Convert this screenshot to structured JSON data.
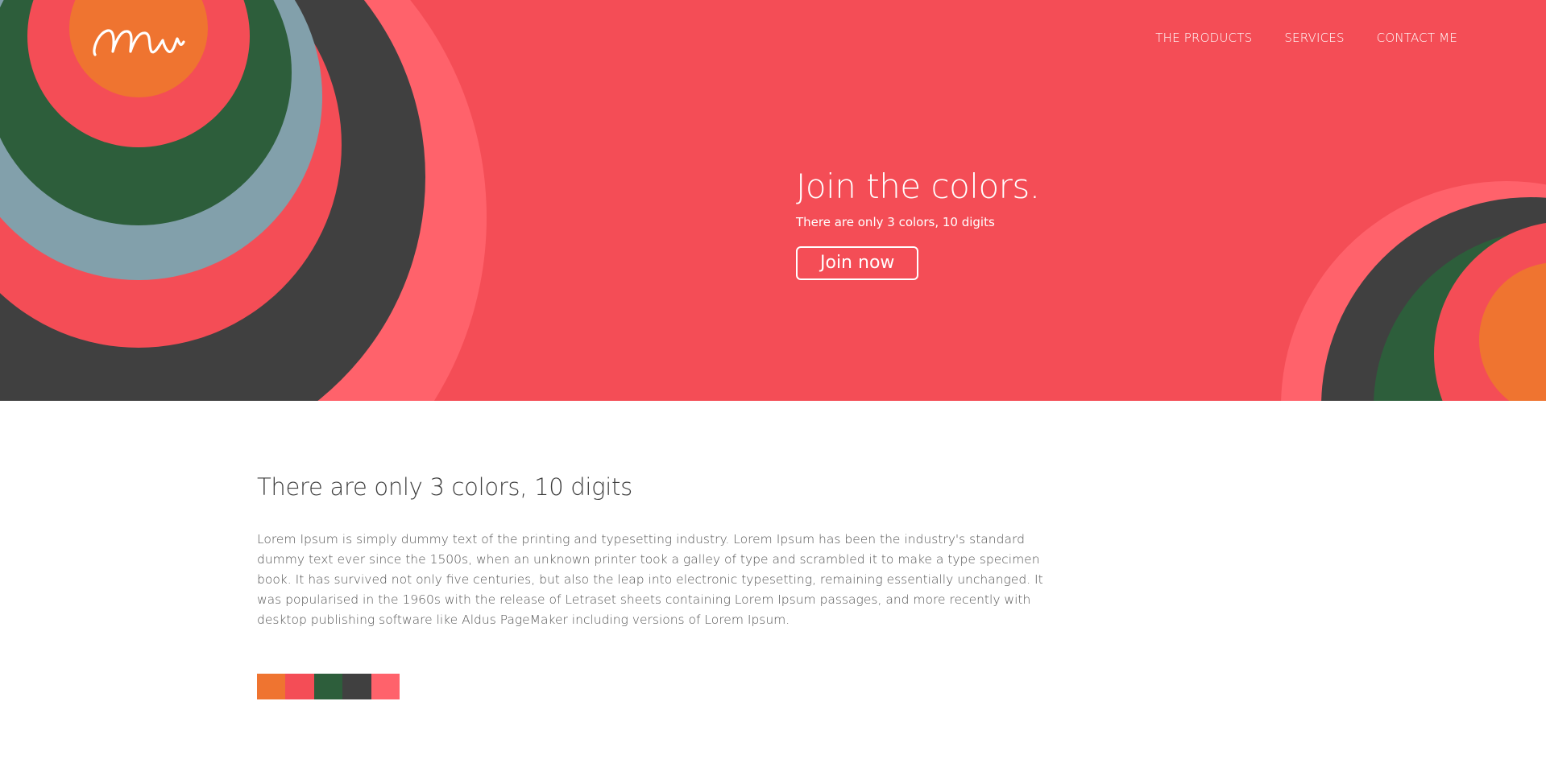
{
  "brand": {
    "logo_text": "Mw"
  },
  "nav": {
    "items": [
      {
        "label": "THE PRODUCTS"
      },
      {
        "label": "SERVICES"
      },
      {
        "label": "CONTACT ME"
      }
    ]
  },
  "hero": {
    "title": "Join the colors.",
    "subtitle": "There are only 3 colors, 10 digits",
    "button_label": "Join now"
  },
  "content": {
    "title": "There are only 3 colors, 10 digits",
    "body": "Lorem Ipsum is simply dummy text of the printing and typesetting industry. Lorem Ipsum has been the industry's standard dummy text ever since the 1500s, when an unknown printer took a galley of type and scrambled it to make a type specimen book. It has survived not only five centuries, but also the leap into electronic typesetting, remaining essentially unchanged. It was popularised in the 1960s with the release of Letraset sheets containing Lorem Ipsum passages, and more recently with desktop publishing software like Aldus PageMaker including versions of Lorem Ipsum."
  },
  "colors": {
    "orange": "#ef7430",
    "red": "#f44d56",
    "green": "#2d5e3b",
    "dark": "#404040",
    "pink": "#ff626b",
    "slate": "#82a0ab"
  },
  "swatches": [
    "#ef7430",
    "#f44d56",
    "#2d5e3b",
    "#404040",
    "#ff626b"
  ]
}
